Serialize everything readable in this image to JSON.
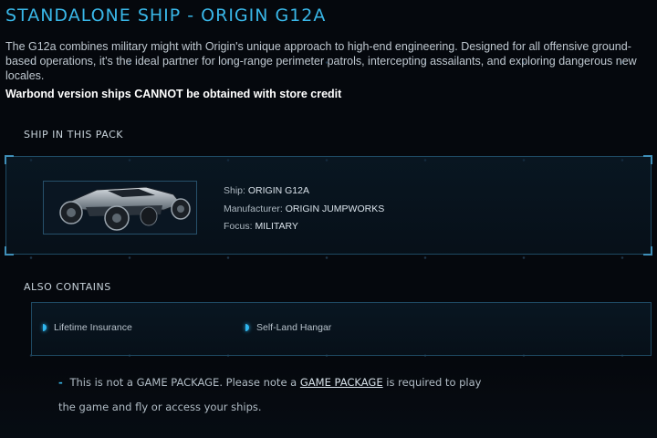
{
  "header": {
    "title": "STANDALONE SHIP - ORIGIN G12A",
    "description": "The G12a combines military might with Origin's unique approach to high-end engineering. Designed for all offensive ground-based operations, it's the ideal partner for long-range perimeter patrols, intercepting assailants, and exploring dangerous new locales.",
    "warning": "Warbond version ships CANNOT be obtained with store credit"
  },
  "ship_section": {
    "label": "SHIP IN THIS PACK",
    "ship_label": "Ship:",
    "ship_value": "ORIGIN G12A",
    "manufacturer_label": "Manufacturer:",
    "manufacturer_value": "ORIGIN JUMPWORKS",
    "focus_label": "Focus:",
    "focus_value": "MILITARY"
  },
  "also_contains": {
    "label": "ALSO CONTAINS",
    "items": [
      "Lifetime Insurance",
      "Self-Land Hangar"
    ]
  },
  "note": {
    "dash": "-",
    "text_before": "This is not a GAME PACKAGE. Please note a",
    "link": "GAME PACKAGE",
    "text_after": "is required to play the game and fly or access your ships."
  },
  "colors": {
    "accent": "#39b7e8",
    "background": "#05080d",
    "panel_border": "#1e4962"
  }
}
